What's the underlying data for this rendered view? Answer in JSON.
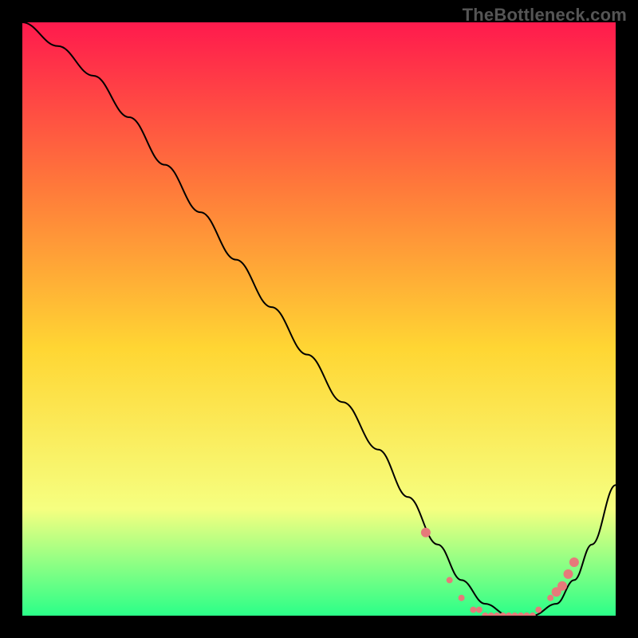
{
  "watermark": "TheBottleneck.com",
  "chart_data": {
    "type": "line",
    "title": "",
    "xlabel": "",
    "ylabel": "",
    "xlim": [
      0,
      100
    ],
    "ylim": [
      0,
      100
    ],
    "grid": false,
    "background_gradient": {
      "top": "#ff1a4d",
      "upper_mid": "#ff7a3a",
      "mid": "#ffd633",
      "lower_mid": "#f6ff80",
      "bottom": "#2bff88"
    },
    "series": [
      {
        "name": "bottleneck-curve",
        "x": [
          0,
          6,
          12,
          18,
          24,
          30,
          36,
          42,
          48,
          54,
          60,
          65,
          70,
          74,
          78,
          82,
          86,
          90,
          93,
          96,
          100
        ],
        "y": [
          100,
          96,
          91,
          84,
          76,
          68,
          60,
          52,
          44,
          36,
          28,
          20,
          12,
          6,
          2,
          0,
          0,
          2,
          6,
          12,
          22
        ],
        "color": "#000000",
        "line_width": 2
      }
    ],
    "markers": {
      "name": "highlight-points",
      "color": "#e67a7a",
      "radius_small": 4,
      "radius_large": 6,
      "x": [
        68,
        72,
        74,
        76,
        77,
        78,
        79,
        80,
        81,
        82,
        83,
        84,
        85,
        86,
        87,
        89,
        90,
        91,
        92,
        93
      ],
      "y": [
        14,
        6,
        3,
        1,
        1,
        0,
        0,
        0,
        0,
        0,
        0,
        0,
        0,
        0,
        1,
        3,
        4,
        5,
        7,
        9
      ],
      "large_idx": [
        0,
        16,
        17,
        18,
        19
      ]
    }
  }
}
